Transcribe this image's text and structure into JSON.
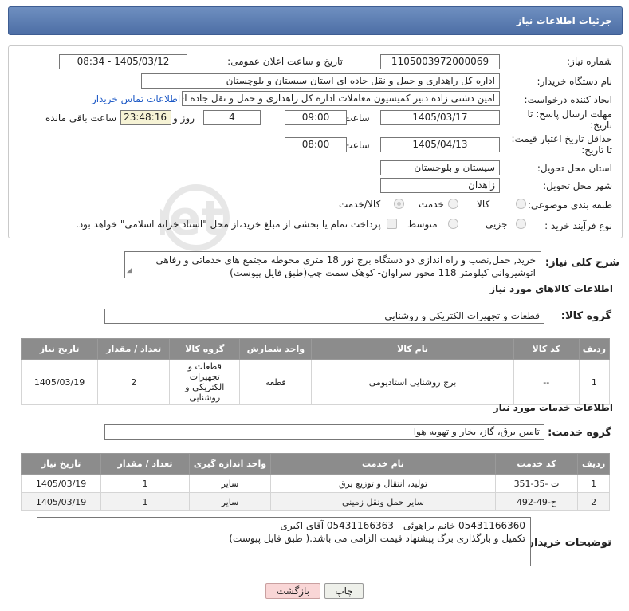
{
  "header": {
    "title": "جزئیات اطلاعات نیاز"
  },
  "fields": {
    "need_number_label": "شماره نیاز:",
    "need_number": "1105003972000069",
    "announce_label": "تاریخ و ساعت اعلان عمومی:",
    "announce_value": "1405/03/12 - 08:34",
    "buyer_org_label": "نام دستگاه خریدار:",
    "buyer_org": "اداره کل راهداری و حمل و نقل جاده ای استان سیستان و بلوچستان",
    "creator_label": "ایجاد کننده درخواست:",
    "creator": "امین دشتی زاده دبیر کمیسیون معاملات اداره کل راهداری و حمل و نقل جاده ای",
    "contact_link": "اطلاعات تماس خریدار",
    "deadline_label_1": "مهلت ارسال پاسخ: تا",
    "deadline_label_2": "تاریخ:",
    "deadline_date": "1405/03/17",
    "time_label": "ساعت",
    "deadline_time": "09:00",
    "days_value": "4",
    "days_label": "روز و",
    "remaining_time": "23:48:16",
    "remaining_label": "ساعت باقی مانده",
    "validity_label_1": "حداقل تاریخ اعتبار قیمت:",
    "validity_label_2": "تا تاریخ:",
    "validity_date": "1405/04/13",
    "validity_time_label": "ساعت",
    "validity_time": "08:00",
    "province_label": "استان محل تحویل:",
    "province": "سیستان و بلوچستان",
    "city_label": "شهر محل تحویل:",
    "city": "زاهدان",
    "category_label": "طبقه بندی موضوعی:",
    "category_options": [
      "کالا",
      "خدمت",
      "کالا/خدمت"
    ],
    "purchase_type_label": "نوع فرآیند خرید :",
    "purchase_options": [
      "جزیی",
      "متوسط"
    ],
    "payment_note": "پرداخت تمام یا بخشی از مبلغ خرید،از محل \"اسناد خزانه اسلامی\" خواهد بود."
  },
  "description": {
    "label": "شرح کلی نیاز:",
    "text": "خرید, حمل,نصب و راه اندازی دو دستگاه برج نور 18 متری محوطه مجتمع های خدماتی و رفاهی اتوشیروانی کیلومتر 118 محور سراوان- کوهک سمت چپ(طبق فایل پیوست)"
  },
  "goods": {
    "section_title": "اطلاعات کالاهای مورد نیاز",
    "group_label": "گروه کالا:",
    "group_value": "قطعات و تجهیزات الکتریکی و روشنایی",
    "columns": [
      "ردیف",
      "کد کالا",
      "نام کالا",
      "واحد شمارش",
      "گروه کالا",
      "تعداد / مقدار",
      "تاریخ نیاز"
    ],
    "rows": [
      [
        "1",
        "--",
        "برج روشنایی استادیومی",
        "قطعه",
        "قطعات و تجهیزات الکتریکی و روشنایی",
        "2",
        "1405/03/19"
      ]
    ]
  },
  "services": {
    "section_title": "اطلاعات خدمات مورد نیاز",
    "group_label": "گروه خدمت:",
    "group_value": "تامین برق، گاز، بخار و تهویه هوا",
    "columns": [
      "ردیف",
      "کد خدمت",
      "نام خدمت",
      "واحد اندازه گیری",
      "تعداد / مقدار",
      "تاریخ نیاز"
    ],
    "rows": [
      [
        "1",
        "ت -35-351",
        "تولید، انتقال و توزیع برق",
        "سایر",
        "1",
        "1405/03/19"
      ],
      [
        "2",
        "ح-49-492",
        "سایر حمل ونقل زمینی",
        "سایر",
        "1",
        "1405/03/19"
      ]
    ]
  },
  "buyer_notes": {
    "label": "توضیحات خریدار:",
    "line1": "05431166360 خانم براهوئی - 05431166363 آقای اکبری",
    "line2": "تکمیل و بارگذاری برگ پیشنهاد قیمت الزامی می باشد.( طبق فایل پیوست)"
  },
  "buttons": {
    "print": "چاپ",
    "back": "بازگشت"
  }
}
